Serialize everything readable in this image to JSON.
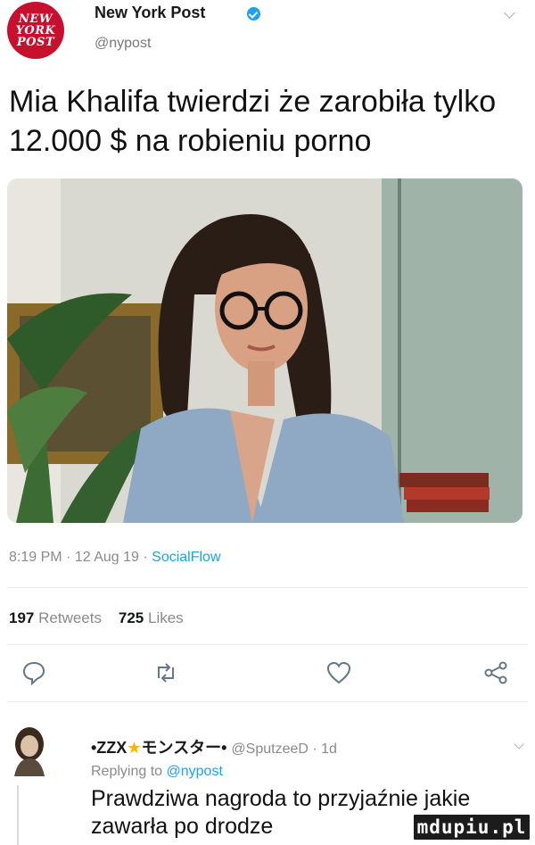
{
  "tweet": {
    "account": {
      "logo_lines": [
        "NEW",
        "YORK",
        "POST"
      ],
      "name": "New York Post",
      "verified_icon": "verified-badge-icon",
      "handle": "@nypost"
    },
    "text": "Mia Khalifa twierdzi że zarobiła tylko 12.000 $ na robieniu porno",
    "meta": {
      "time": "8:19 PM",
      "date": "12 Aug 19",
      "separator": "·",
      "source": "SocialFlow"
    },
    "stats": {
      "retweets_count": "197",
      "retweets_label": "Retweets",
      "likes_count": "725",
      "likes_label": "Likes"
    },
    "actions": [
      "reply-icon",
      "retweet-icon",
      "like-icon",
      "share-icon"
    ]
  },
  "reply": {
    "name_part1": "•ZZX",
    "name_star": "★",
    "name_part2": "モンスター•",
    "handle": "@SputzeeD · 1d",
    "context_prefix": "Replying to",
    "context_mention": "@nypost",
    "text": "Prawdziwa nagroda to przyjaźnie jakie zawarła po drodze"
  },
  "watermark": "mdupiu.pl",
  "colors": {
    "link": "#1da1f2",
    "brand_red": "#c8102e",
    "muted": "#8a8a8a"
  }
}
